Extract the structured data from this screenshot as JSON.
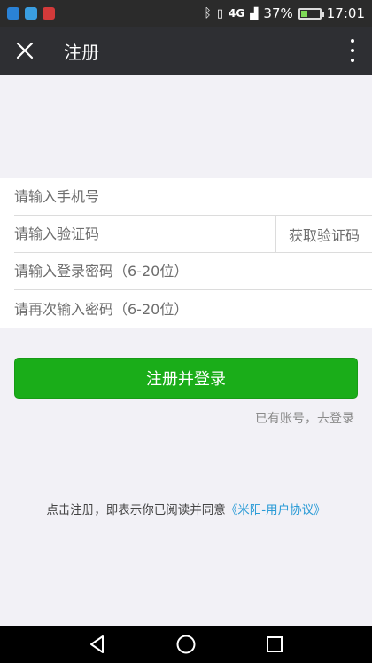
{
  "status_bar": {
    "signal": "4G",
    "battery": "37%",
    "battery_level": 0.37,
    "time": "17:01"
  },
  "header": {
    "title": "注册"
  },
  "form": {
    "phone_placeholder": "请输入手机号",
    "code_placeholder": "请输入验证码",
    "get_code_label": "获取验证码",
    "password_placeholder": "请输入登录密码（6-20位）",
    "confirm_placeholder": "请再次输入密码（6-20位）"
  },
  "submit_label": "注册并登录",
  "login_link": "已有账号，去登录",
  "agreement": {
    "prefix": "点击注册，即表示你已阅读并同意",
    "link": "《米阳-用户协议》"
  },
  "colors": {
    "primary": "#1aad19",
    "link": "#2a9bd6",
    "header_bg": "#2e2f33"
  }
}
